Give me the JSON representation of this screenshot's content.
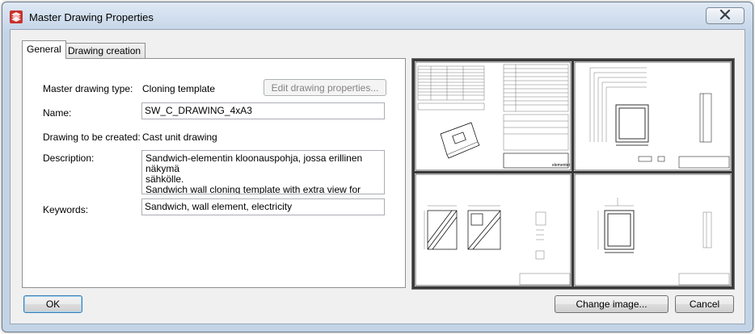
{
  "window": {
    "title": "Master Drawing Properties",
    "icons": {
      "app": "tekla-app-icon",
      "close": "close-icon"
    }
  },
  "tabs": [
    {
      "label": "General",
      "active": true
    },
    {
      "label": "Drawing creation",
      "active": false
    }
  ],
  "form": {
    "master_drawing_type_label": "Master drawing type:",
    "master_drawing_type_value": "Cloning template",
    "edit_properties_button": "Edit drawing properties...",
    "name_label": "Name:",
    "name_value": "SW_C_DRAWING_4xA3",
    "drawing_to_be_created_label": "Drawing to be created:",
    "drawing_to_be_created_value": "Cast unit drawing",
    "description_label": "Description:",
    "description_value": "Sandwich-elementin kloonauspohja, jossa erillinen näkymä\nsähkölle.\nSandwich wall cloning template with extra view for electricity.",
    "keywords_label": "Keywords:",
    "keywords_value": "Sandwich, wall element, electricity"
  },
  "buttons": {
    "ok": "OK",
    "change_image": "Change image...",
    "cancel": "Cancel"
  },
  "preview": {
    "sheet_count": 4,
    "brand_text": "elementer"
  },
  "colors": {
    "title_bar": "#c9d8ea",
    "close_red": "#c0392b",
    "preview_bg": "#3a3a3a"
  }
}
